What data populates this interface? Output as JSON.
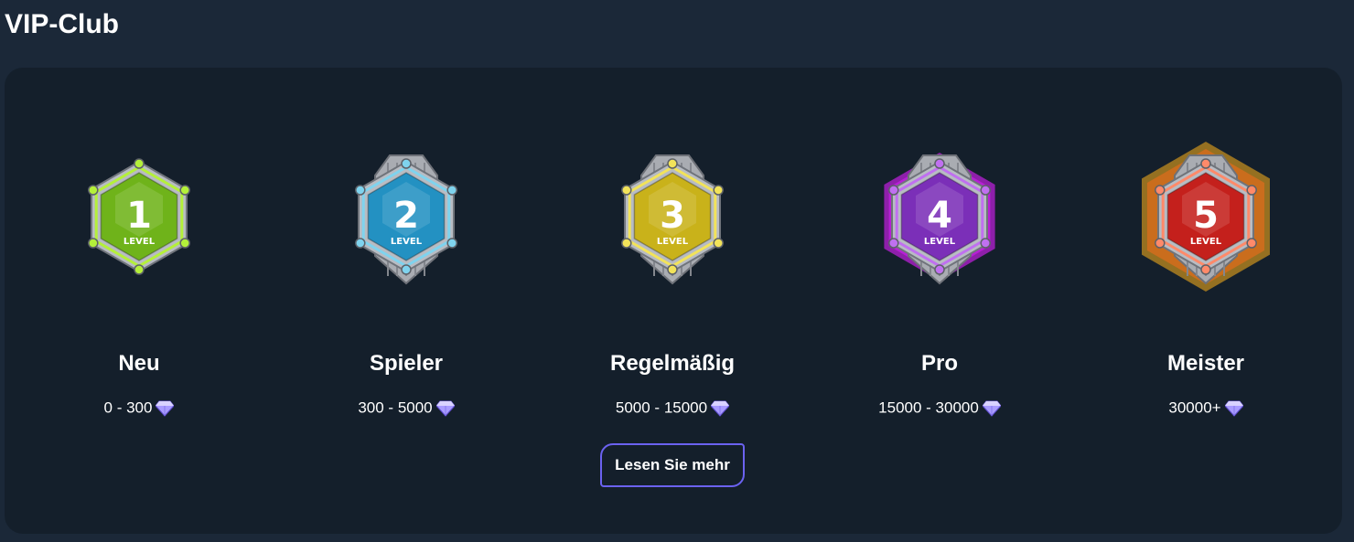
{
  "page": {
    "title": "VIP-Club"
  },
  "vip_levels": [
    {
      "number": "1",
      "badge_text": "LEVEL",
      "name": "Neu",
      "range": "0 - 300",
      "color": "#6fb31a",
      "rim": "#b4f03a",
      "icon": "level-1-badge-icon"
    },
    {
      "number": "2",
      "badge_text": "LEVEL",
      "name": "Spieler",
      "range": "300 - 5000",
      "color": "#2391c2",
      "rim": "#7fd3ee",
      "icon": "level-2-badge-icon"
    },
    {
      "number": "3",
      "badge_text": "LEVEL",
      "name": "Regelmäßig",
      "range": "5000 - 15000",
      "color": "#c9b21a",
      "rim": "#f2e35a",
      "icon": "level-3-badge-icon"
    },
    {
      "number": "4",
      "badge_text": "LEVEL",
      "name": "Pro",
      "range": "15000 - 30000",
      "color": "#7b2fb8",
      "rim": "#c070f0",
      "glow": "#e020ff",
      "icon": "level-4-badge-icon"
    },
    {
      "number": "5",
      "badge_text": "LEVEL",
      "name": "Meister",
      "range": "30000+",
      "color": "#c4201c",
      "rim": "#ff8a6a",
      "glow": "#ffb21a",
      "icon": "level-5-badge-icon"
    }
  ],
  "currency_icon": "diamond-icon",
  "read_more": {
    "label": "Lesen Sie mehr"
  },
  "colors": {
    "background": "#1b2838",
    "card": "#141f2b",
    "accent_border": "#6b62f0",
    "diamond": "#a99bff"
  }
}
